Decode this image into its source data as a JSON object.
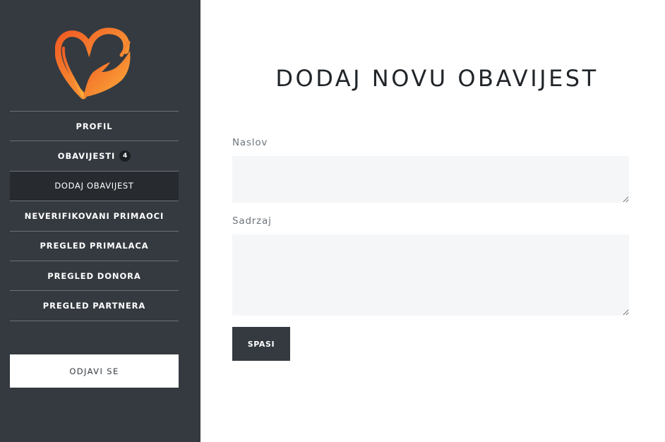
{
  "sidebar": {
    "logo_icon": "heart-hand-icon",
    "items": [
      {
        "label": "PROFIL"
      },
      {
        "label": "OBAVIJESTI",
        "badge": "4"
      },
      {
        "label": "DODAJ OBAVIJEST",
        "active": true
      },
      {
        "label": "NEVERIFIKOVANI PRIMAOCI"
      },
      {
        "label": "PREGLED PRIMALACA"
      },
      {
        "label": "PREGLED DONORA"
      },
      {
        "label": "PREGLED PARTNERA"
      }
    ],
    "logout_label": "ODJAVI SE"
  },
  "main": {
    "title": "DODAJ NOVU OBAVIJEST",
    "form": {
      "title_label": "Naslov",
      "title_value": "",
      "content_label": "Sadrzaj",
      "content_value": "",
      "save_label": "SPASI"
    }
  },
  "colors": {
    "sidebar_bg": "#343a40",
    "active_item_bg": "#272b30",
    "field_bg": "#f5f6f8",
    "logo_gradient_start": "#f15a24",
    "logo_gradient_end": "#fbb03b"
  }
}
